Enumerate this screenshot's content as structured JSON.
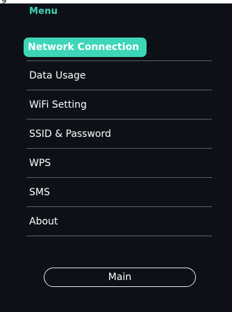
{
  "top_fragment": "g",
  "menu": {
    "title": "Menu",
    "items": [
      {
        "label": "Network Connection",
        "active": true
      },
      {
        "label": "Data Usage",
        "active": false
      },
      {
        "label": "WiFi Setting",
        "active": false
      },
      {
        "label": "SSID & Password",
        "active": false
      },
      {
        "label": "WPS",
        "active": false
      },
      {
        "label": "SMS",
        "active": false
      },
      {
        "label": "About",
        "active": false
      }
    ]
  },
  "main_button": {
    "label": "Main"
  },
  "colors": {
    "background": "#0d1117",
    "accent": "#3ed6b8",
    "text": "#ffffff",
    "divider": "#5c6168"
  }
}
